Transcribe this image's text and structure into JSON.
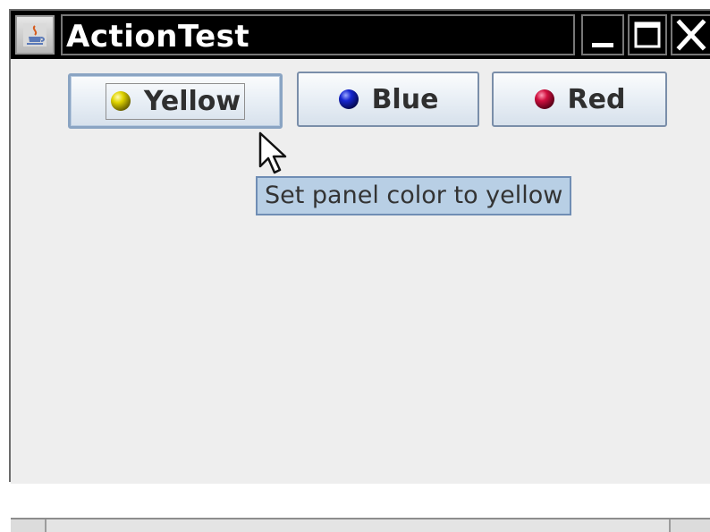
{
  "window": {
    "title": "ActionTest",
    "controls": {
      "minimize_icon": "minimize-icon",
      "maximize_icon": "maximize-icon",
      "close_icon": "close-icon"
    }
  },
  "buttons": [
    {
      "label": "Yellow",
      "icon": "yellow-ball-icon",
      "icon_color": "#d4cc00",
      "focused": true
    },
    {
      "label": "Blue",
      "icon": "blue-ball-icon",
      "icon_color": "#1020c8"
    },
    {
      "label": "Red",
      "icon": "red-ball-icon",
      "icon_color": "#cc1040"
    }
  ],
  "tooltip": {
    "text": "Set panel color to yellow"
  },
  "colors": {
    "panel_background": "#eeeeee",
    "titlebar": "#000000",
    "tooltip_background": "#b8cfe5",
    "button_border": "#7a8ea9"
  }
}
